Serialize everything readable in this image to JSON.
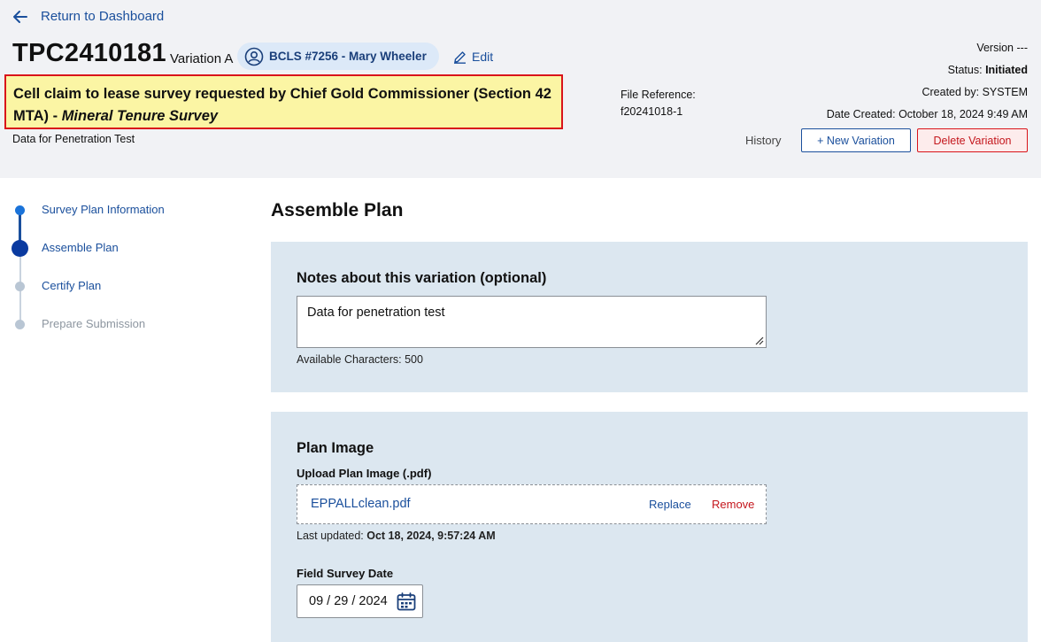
{
  "header": {
    "back_label": "Return to Dashboard",
    "plan_id": "TPC2410181",
    "variation": "Variation A",
    "user_chip": "BCLS #7256 - Mary Wheeler",
    "edit_label": "Edit",
    "title_main": "Cell claim to lease survey requested by Chief Gold Commissioner (Section 42 MTA) - ",
    "title_em": "Mineral Tenure Survey",
    "description": "Data for Penetration Test",
    "file_reference_label": "File Reference:",
    "file_reference_value": "f20241018-1",
    "version_label": "Version",
    "version_value": "---",
    "status_label": "Status:",
    "status_value": "Initiated",
    "created_by_label": "Created by:",
    "created_by_value": "SYSTEM",
    "date_created_label": "Date Created:",
    "date_created_value": "October 18, 2024 9:49 AM",
    "history_label": "History",
    "new_variation_label": "+ New Variation",
    "delete_variation_label": "Delete Variation"
  },
  "stepper": {
    "steps": [
      {
        "label": "Survey Plan Information",
        "state": "completed"
      },
      {
        "label": "Assemble Plan",
        "state": "current"
      },
      {
        "label": "Certify Plan",
        "state": "upcoming"
      },
      {
        "label": "Prepare Submission",
        "state": "disabled"
      }
    ]
  },
  "main": {
    "title": "Assemble Plan",
    "notes": {
      "heading": "Notes about this variation (optional)",
      "value": "Data for penetration test",
      "available_label": "Available Characters:",
      "available_value": "500"
    },
    "plan_image": {
      "heading": "Plan Image",
      "upload_label": "Upload Plan Image (.pdf)",
      "file_name": "EPPALLclean.pdf",
      "replace_label": "Replace",
      "remove_label": "Remove",
      "last_updated_label": "Last updated:",
      "last_updated_value": "Oct 18, 2024, 9:57:24 AM",
      "field_survey_date_label": "Field Survey Date",
      "field_survey_date_value": "09 / 29 / 2024"
    }
  },
  "colors": {
    "primary": "#1a4f9c",
    "danger": "#d9141a",
    "header_bg": "#f1f2f5",
    "panel_bg": "#dce7f0",
    "highlight": "#fbf5a4"
  }
}
